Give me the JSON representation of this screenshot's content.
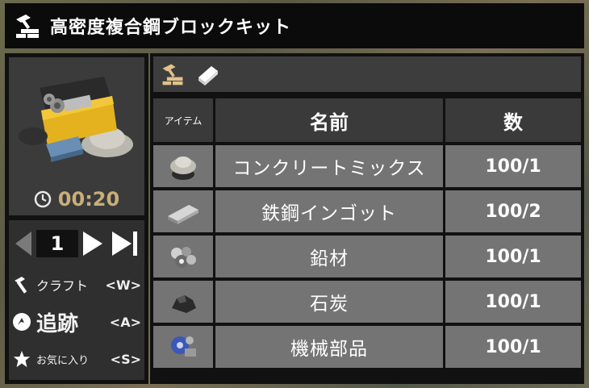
{
  "window": {
    "title": "高密度複合鋼ブロックキット",
    "title_icon": "crafting-workbench-icon"
  },
  "preview": {
    "craft_time": "00:20",
    "clock_icon": "clock-icon"
  },
  "quantity": {
    "value": "1",
    "decrease_icon": "triangle-left-icon",
    "increase_icon": "triangle-right-icon",
    "max_icon": "skip-to-max-icon"
  },
  "actions": [
    {
      "label": "クラフト",
      "key": "<W>",
      "icon": "hammer-icon"
    },
    {
      "label": "追跡",
      "key": "<A>",
      "icon": "track-icon"
    },
    {
      "label": "お気に入り",
      "key": "<S>",
      "icon": "star-icon"
    }
  ],
  "tabs": [
    {
      "icon": "crafting-workbench-icon"
    },
    {
      "icon": "recipe-book-icon"
    }
  ],
  "table": {
    "headers": {
      "item": "アイテム",
      "name": "名前",
      "count": "数"
    },
    "rows": [
      {
        "name": "コンクリートミックス",
        "count": "100/1",
        "icon": "concrete-mix-icon"
      },
      {
        "name": "鉄鋼インゴット",
        "count": "100/2",
        "icon": "steel-ingot-icon"
      },
      {
        "name": "鉛材",
        "count": "100/1",
        "icon": "lead-icon"
      },
      {
        "name": "石炭",
        "count": "100/1",
        "icon": "coal-icon"
      },
      {
        "name": "機械部品",
        "count": "100/1",
        "icon": "machine-parts-icon"
      }
    ]
  },
  "colors": {
    "timer": "#c8ae7a",
    "row_bg": "#747474",
    "header_bg": "#3a3a3a"
  }
}
